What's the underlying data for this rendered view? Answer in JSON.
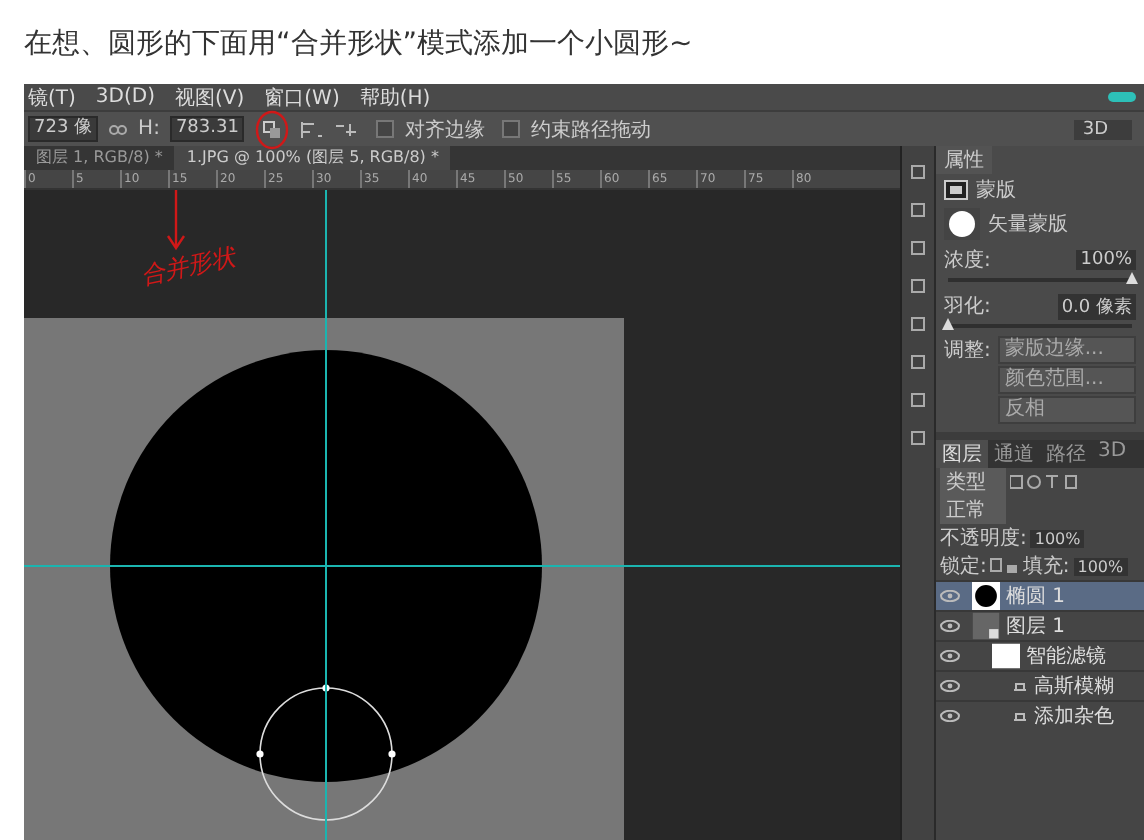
{
  "caption": "在想、圆形的下面用“合并形状”模式添加一个小圆形~",
  "ps": {
    "menu": [
      "镜(T)",
      "3D(D)",
      "视图(V)",
      "窗口(W)",
      "帮助(H)"
    ],
    "options": {
      "width_value": "723 像",
      "height_label": "H:",
      "height_value": "783.31",
      "align_edges": {
        "label": "对齐边缘",
        "checked": false
      },
      "constrain": {
        "label": "约束路径拖动",
        "checked": false
      },
      "workspace": "3D"
    },
    "doc_tabs": [
      {
        "label": "图层 1, RGB/8) *",
        "selected": false
      },
      {
        "label": "1.JPG @ 100% (图层 5, RGB/8) *",
        "selected": true
      }
    ],
    "ruler": [
      "0",
      "5",
      "10",
      "15",
      "20",
      "25",
      "30",
      "35",
      "40",
      "45",
      "50",
      "55",
      "60",
      "65",
      "70",
      "75",
      "80"
    ],
    "annotation": "合并形状",
    "properties": {
      "tab": "属性",
      "mask_label": "蒙版",
      "vector_mask": "矢量蒙版",
      "density": {
        "label": "浓度:",
        "value": "100%",
        "level": 1
      },
      "feather": {
        "label": "羽化:",
        "value": "0.0 像素",
        "level": 0
      },
      "adjust_label": "调整:",
      "buttons": [
        "蒙版边缘...",
        "颜色范围...",
        "反相"
      ]
    },
    "layers": {
      "tabs": [
        {
          "label": "图层",
          "selected": true
        },
        {
          "label": "通道",
          "selected": false
        },
        {
          "label": "路径",
          "selected": false
        },
        {
          "label": "3D",
          "selected": false
        }
      ],
      "filter": "类型",
      "blend": "正常",
      "opacity_label": "不透明度:",
      "opacity": "100%",
      "lock_label": "锁定:",
      "fill_label": "填充:",
      "fill": "100%",
      "items": [
        {
          "kind": "shape",
          "name": "椭圆 1",
          "selected": true,
          "visible": true
        },
        {
          "kind": "smart",
          "name": "图层 1",
          "selected": false,
          "visible": true,
          "children": [
            {
              "kind": "filters",
              "name": "智能滤镜",
              "selected": false,
              "visible": true,
              "children": [
                {
                  "kind": "filter",
                  "name": "高斯模糊",
                  "selected": false,
                  "visible": true
                },
                {
                  "kind": "filter",
                  "name": "添加杂色",
                  "selected": false,
                  "visible": true
                }
              ]
            }
          ]
        }
      ]
    }
  }
}
